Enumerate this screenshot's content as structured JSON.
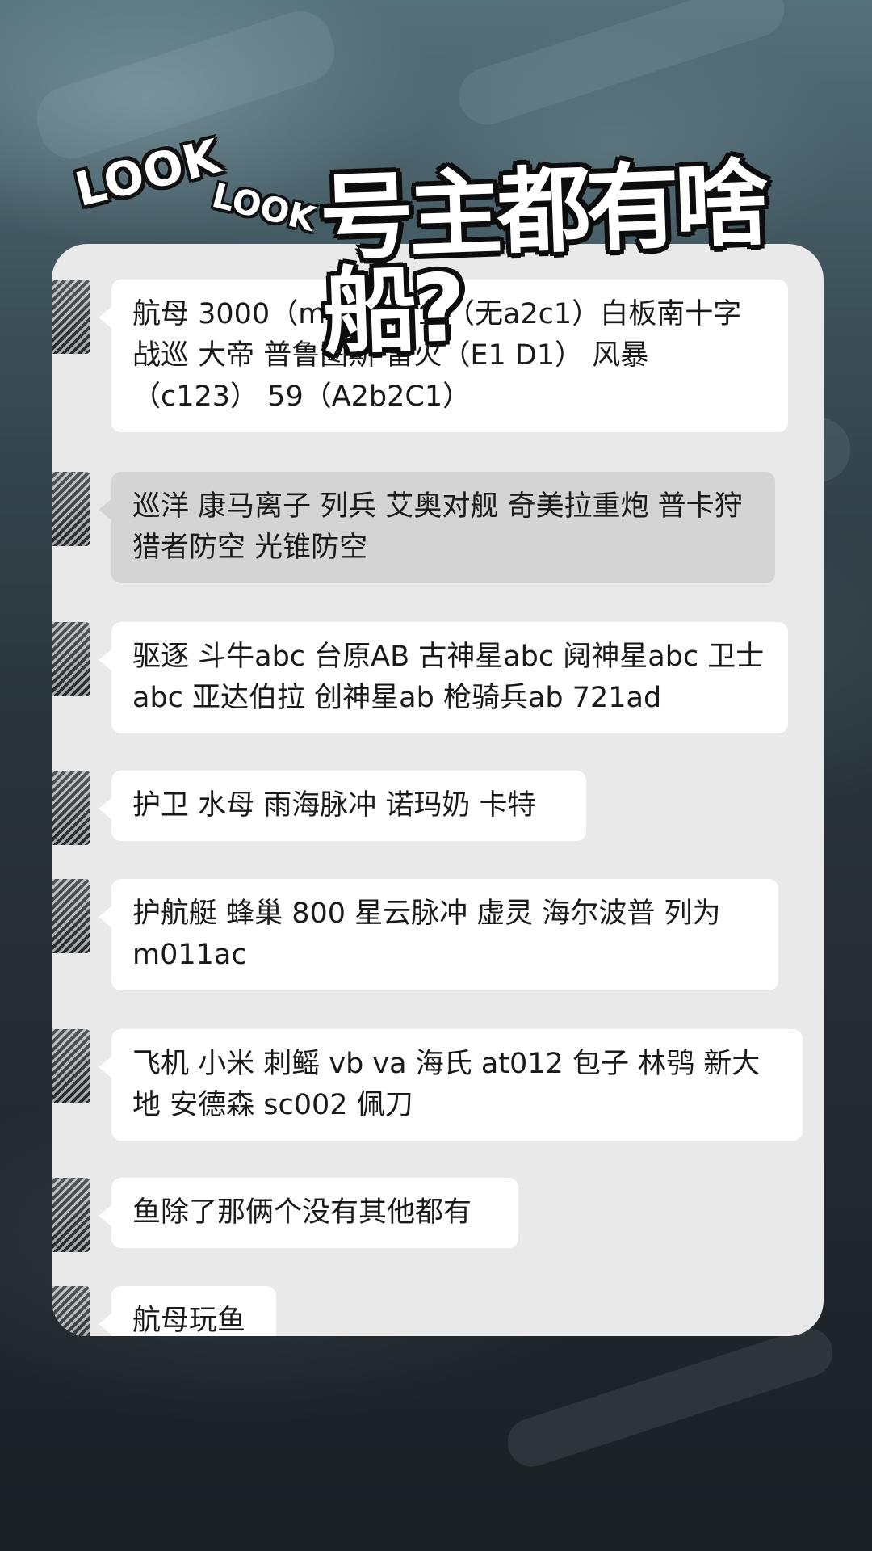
{
  "title": {
    "look_1": "LOOK",
    "look_2": "LOOK",
    "main": "号主都有啥船?"
  },
  "messages": [
    {
      "text": "航母 3000（m3 B2）鱼（无a2c1）白板南十字 战巡 大帝 普鲁图斯 雷火（E1 D1） 风暴（c123） 59（A2b2C1）",
      "highlighted": false
    },
    {
      "text": "巡洋 康马离子 列兵 艾奥对舰 奇美拉重炮 普卡狩猎者防空 光锥防空",
      "highlighted": true
    },
    {
      "text": "驱逐 斗牛abc 台原AB 古神星abc 阋神星abc 卫士abc 亚达伯拉 创神星ab 枪骑兵ab 721ad",
      "highlighted": false
    },
    {
      "text": "护卫 水母 雨海脉冲 诺玛奶 卡特",
      "highlighted": false
    },
    {
      "text": "护航艇 蜂巢 800 星云脉冲 虚灵 海尔波普 列为m011ac",
      "highlighted": false
    },
    {
      "text": "飞机 小米 刺鳐 vb va 海氏 at012 包子 林鸮 新大地 安德森 sc002 佩刀",
      "highlighted": false
    },
    {
      "text": "鱼除了那俩个没有其他都有",
      "highlighted": false
    },
    {
      "text": "航母玩鱼",
      "highlighted": false
    }
  ],
  "colors": {
    "card_background": "#e9e9e9",
    "bubble": "#ffffff",
    "bubble_highlighted": "#d4d4d4",
    "text": "#1a1a1a"
  }
}
